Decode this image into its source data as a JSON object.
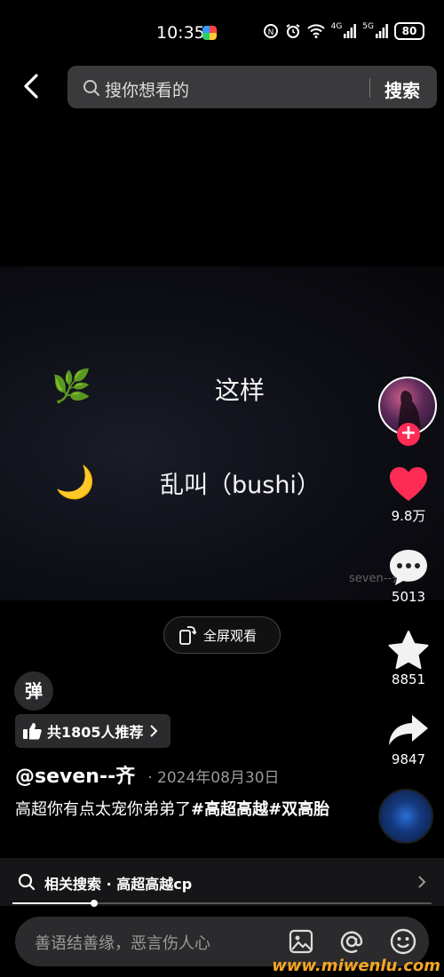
{
  "status_bar": {
    "time": "10:35",
    "network_4g": "4G",
    "network_5g": "5G",
    "battery": "80"
  },
  "search": {
    "placeholder": "搜你想看的",
    "button": "搜索"
  },
  "video": {
    "line1_emoji": "🌿",
    "line1_text": "这样",
    "line2_emoji": "🌙",
    "line2_text": "乱叫（bushi）",
    "watermark": "seven--齐"
  },
  "actions": {
    "likes": "9.8万",
    "comments": "5013",
    "favorites": "8851",
    "shares": "9847"
  },
  "fullscreen_label": "全屏观看",
  "danmu_label": "弹",
  "recommend_label": "共1805人推荐",
  "author": "@seven--齐",
  "date": "2024年08月30日",
  "caption_plain": "高超你有点太宠你弟弟了",
  "caption_tag1": "#高超高越",
  "caption_tag2": "#双高胎",
  "related_search": "相关搜索 · 高超高越cp",
  "progress": {
    "fraction": 0.195
  },
  "comment_placeholder": "善语结善缘，恶言伤人心",
  "site_mark": "www.miwenlu.com"
}
